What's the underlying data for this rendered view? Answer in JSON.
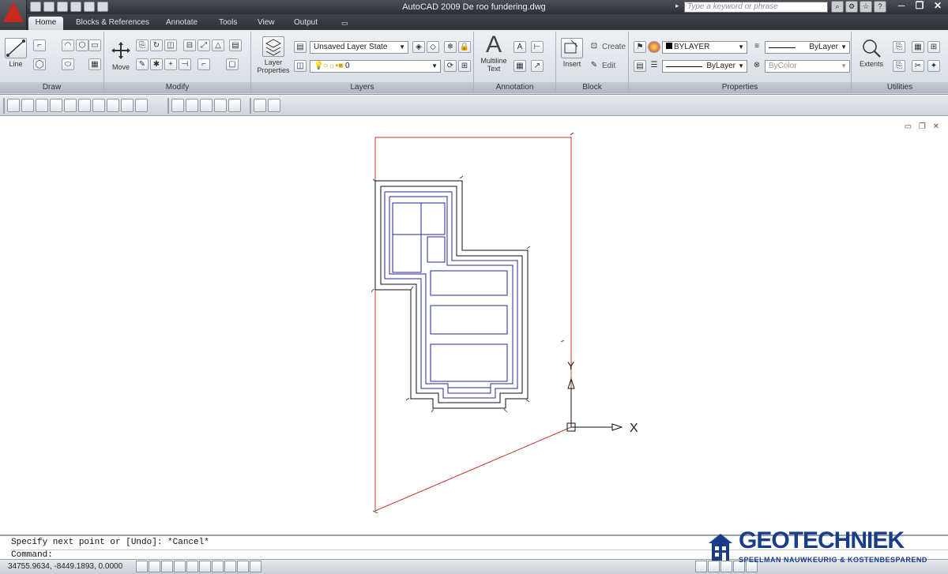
{
  "window": {
    "title": "AutoCAD 2009  De roo fundering.dwg",
    "search_placeholder": "Type a keyword or phrase",
    "controls": [
      "─",
      "❐",
      "✕"
    ]
  },
  "tabs": [
    "Home",
    "Blocks & References",
    "Annotate",
    "Tools",
    "View",
    "Output"
  ],
  "active_tab": "Home",
  "ribbon": {
    "draw": {
      "label": "Draw",
      "line_label": "Line"
    },
    "modify": {
      "label": "Modify",
      "move_label": "Move"
    },
    "layers": {
      "label": "Layers",
      "layer_props_label": "Layer Properties",
      "layer_state": "Unsaved Layer State",
      "current_layer": "0"
    },
    "annotation": {
      "label": "Annotation",
      "mtext_label": "Multiline Text"
    },
    "block": {
      "label": "Block",
      "insert_label": "Insert",
      "create_label": "Create",
      "edit_label": "Edit"
    },
    "properties": {
      "label": "Properties",
      "color": "BYLAYER",
      "linetype": "ByLayer",
      "lineweight": "ByLayer",
      "plotstyle": "ByColor"
    },
    "utilities": {
      "label": "Utilities",
      "extents_label": "Extents"
    }
  },
  "drawing": {
    "ucs_x_label": "X",
    "ucs_y_label": "Y",
    "colors": {
      "boundary": "#c0392b",
      "outer": "#111111",
      "inner": "#2a2a9a"
    }
  },
  "command": {
    "history": "Specify next point or [Undo]: *Cancel*",
    "prompt": "Command:"
  },
  "status": {
    "coordinates": "34755.9634, -8449.1893, 0.0000"
  },
  "watermark": {
    "title": "GEOTECHNIEK",
    "subtitle": "SPEELMAN NAUWKEURIG & KOSTENBESPAREND",
    "color": "#1a3d8a"
  }
}
